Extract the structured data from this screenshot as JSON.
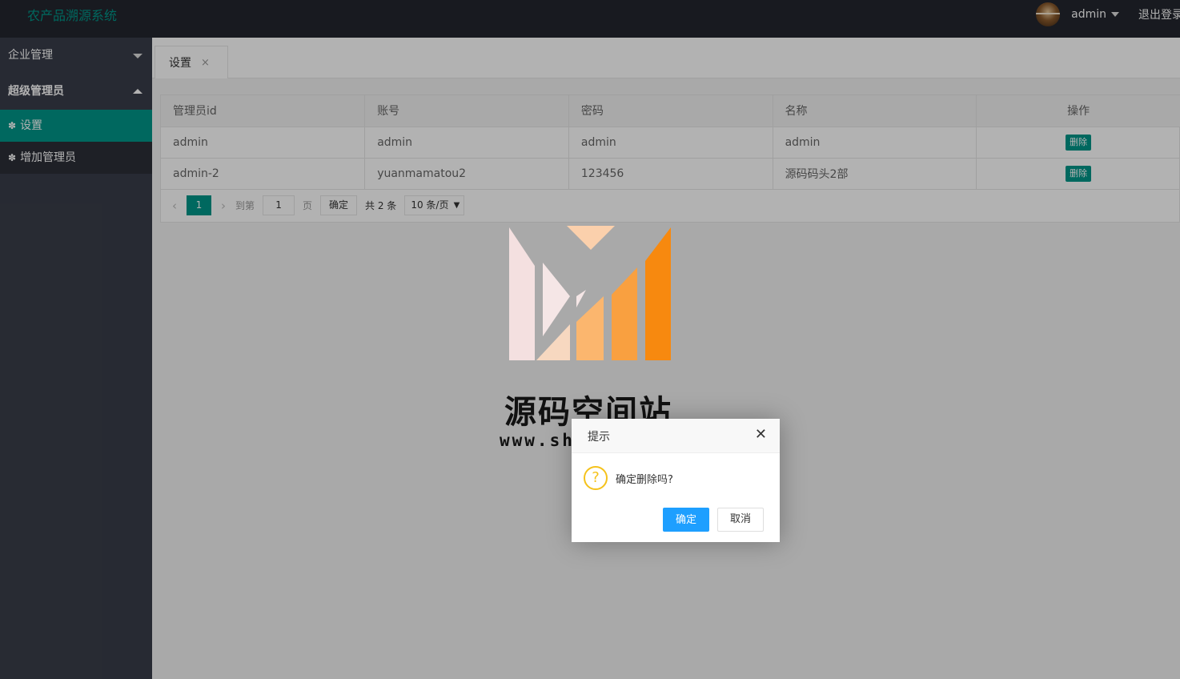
{
  "header": {
    "logo": "农产品溯源系统",
    "user_name": "admin",
    "logout": "退出登录"
  },
  "sidebar": {
    "groups": [
      {
        "label": "企业管理",
        "expanded": false
      },
      {
        "label": "超级管理员",
        "expanded": true,
        "items": [
          {
            "label": "设置",
            "active": true,
            "icon": "gear-icon"
          },
          {
            "label": "增加管理员",
            "active": false,
            "icon": "gear-icon"
          }
        ]
      }
    ]
  },
  "tabs": [
    {
      "label": "设置",
      "close": "×"
    }
  ],
  "table": {
    "headers": [
      "管理员id",
      "账号",
      "密码",
      "名称",
      "操作"
    ],
    "rows": [
      {
        "id": "admin",
        "account": "admin",
        "password": "admin",
        "name": "admin",
        "action": "删除"
      },
      {
        "id": "admin-2",
        "account": "yuanmamatou2",
        "password": "123456",
        "name": "源码码头2部",
        "action": "删除"
      }
    ]
  },
  "pager": {
    "prev": "‹",
    "current": "1",
    "next": "›",
    "goto_label": "到第",
    "goto_value": "1",
    "page_label": "页",
    "confirm": "确定",
    "total": "共 2 条",
    "page_size": "10 条/页",
    "page_size_arrow": "▼"
  },
  "watermark": {
    "title": "源码空间站",
    "url": "www.shuyue.fun"
  },
  "dialog": {
    "title": "提示",
    "close": "✕",
    "icon": "?",
    "message": "确定删除吗?",
    "ok": "确定",
    "cancel": "取消"
  },
  "colors": {
    "header_bg": "#23262e",
    "sidebar_bg": "#393d49",
    "accent": "#009688",
    "primary_button": "#1e9fff",
    "warning_icon": "#f5c21b"
  }
}
